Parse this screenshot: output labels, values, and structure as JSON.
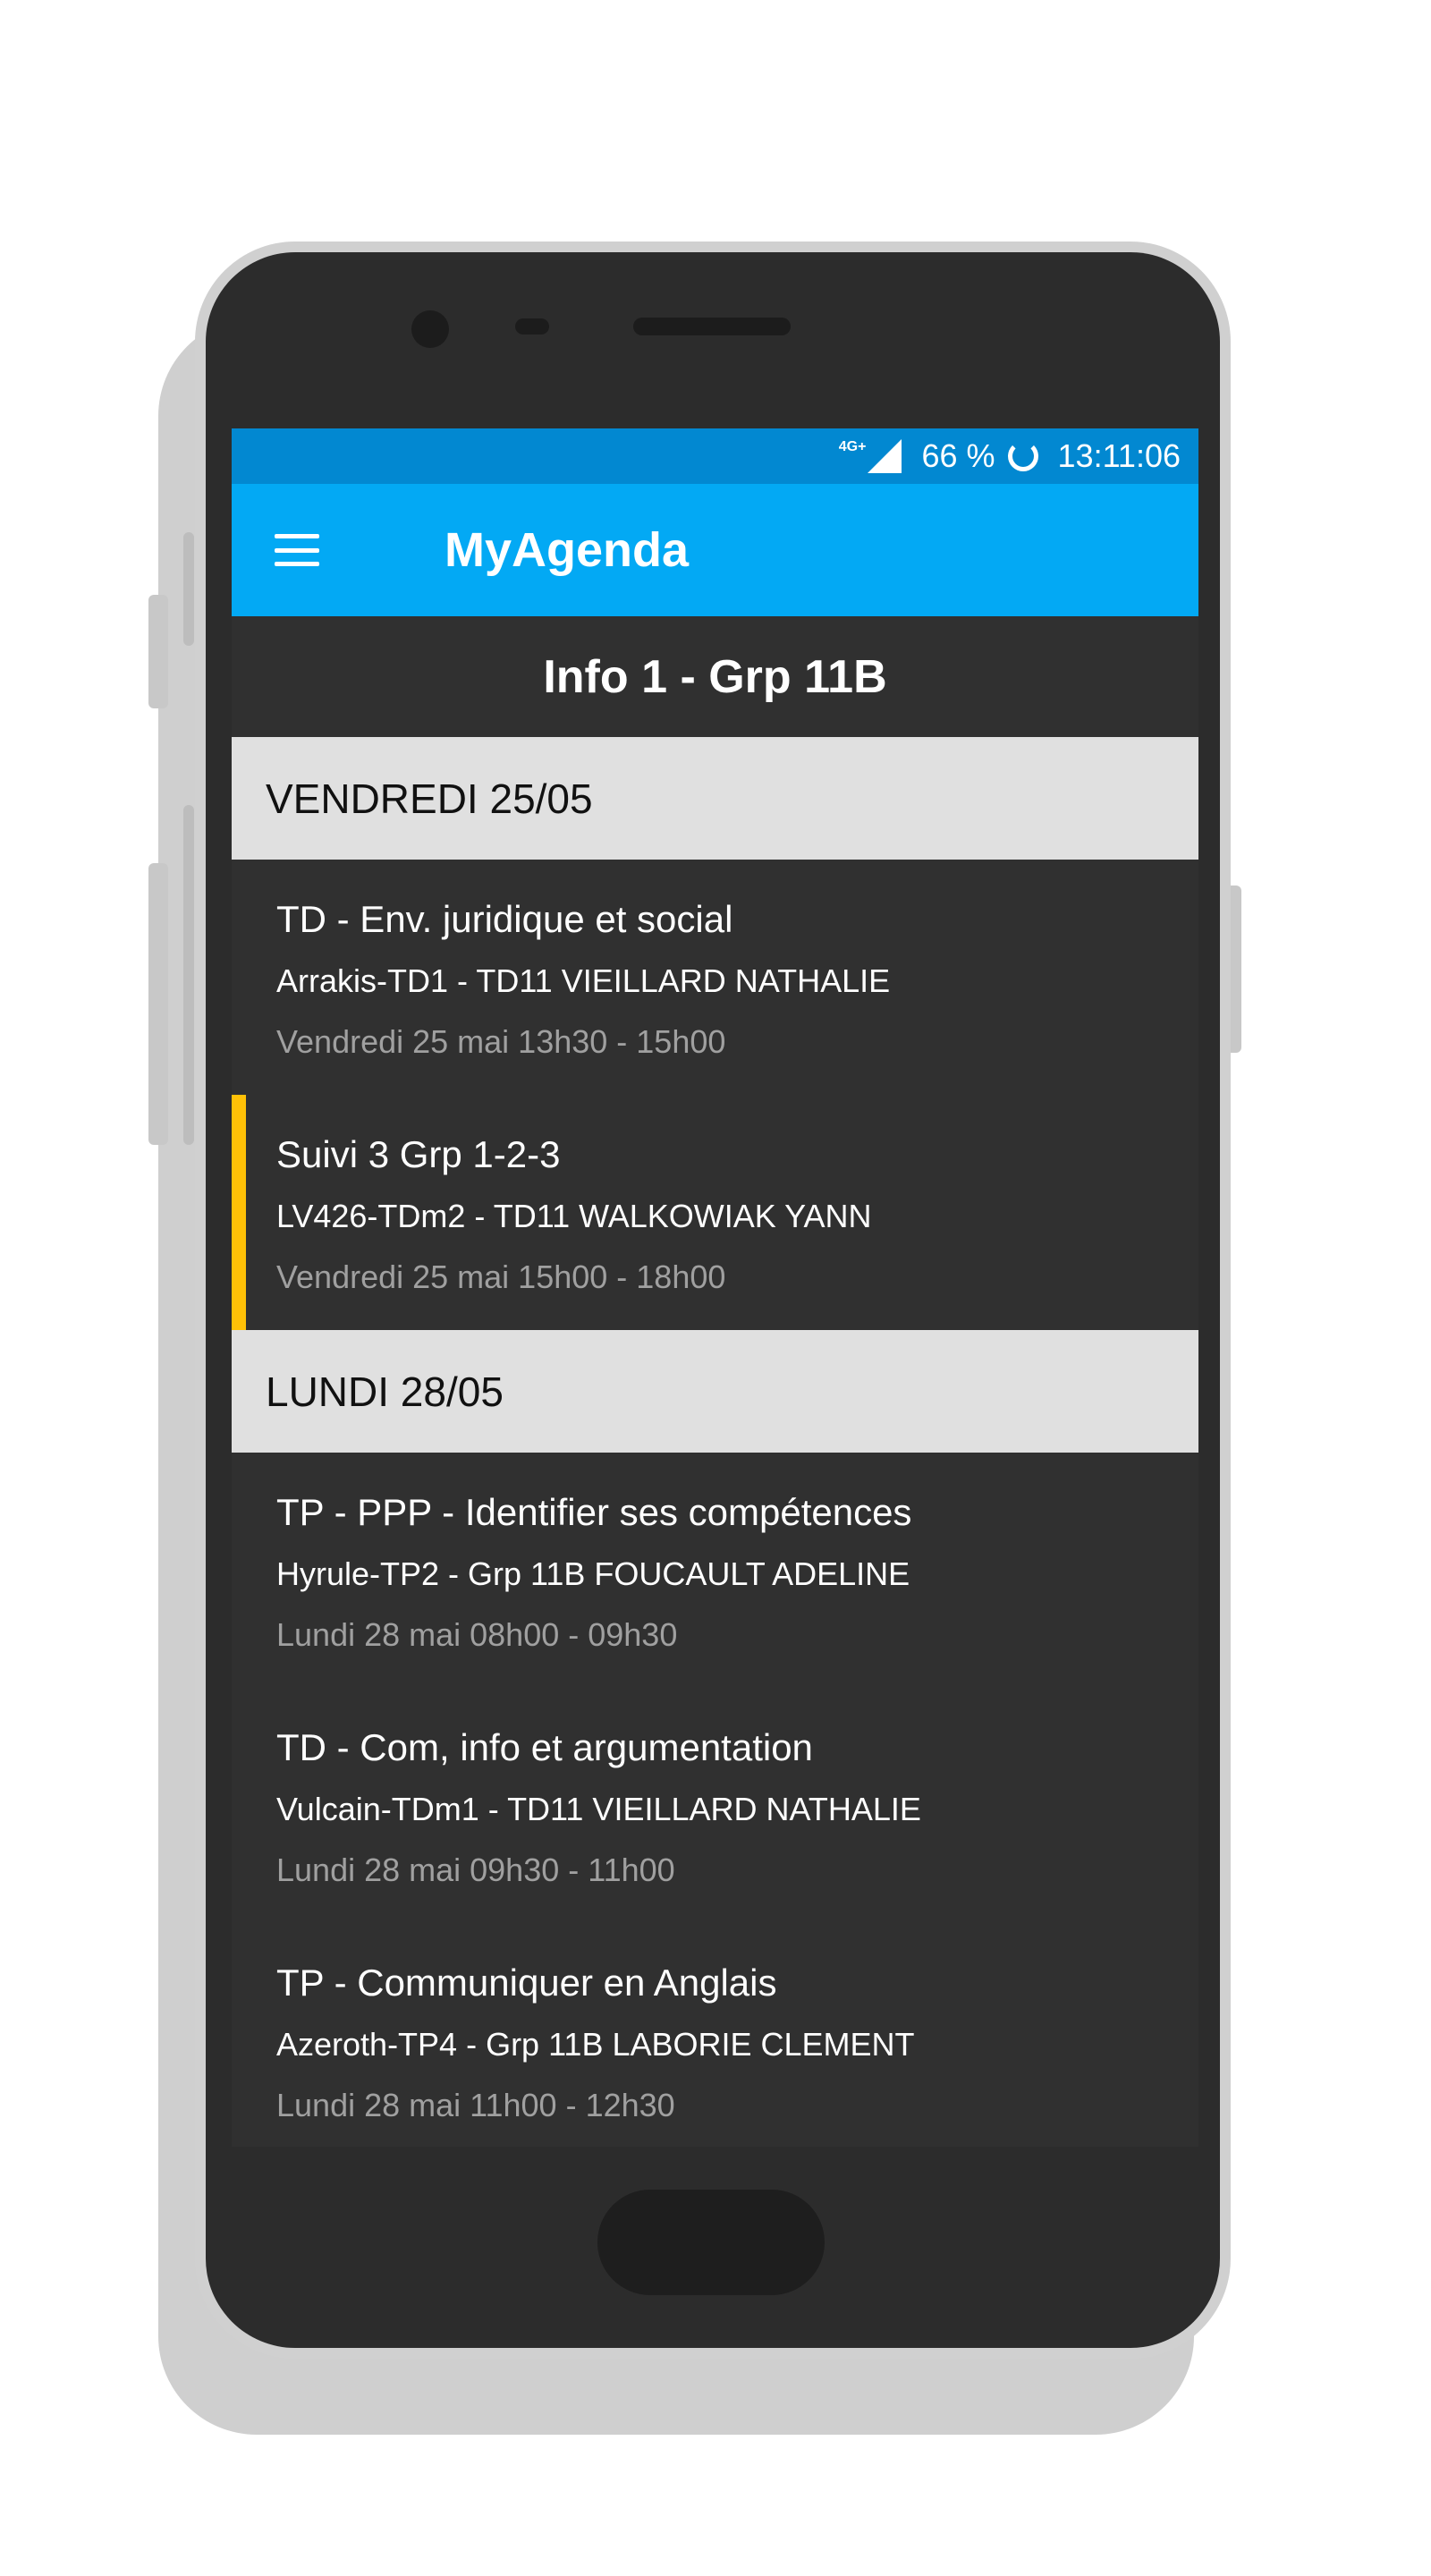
{
  "status_bar": {
    "network": "4G+",
    "battery": "66 %",
    "time": "13:11:06"
  },
  "app_bar": {
    "title": "MyAgenda",
    "menu_icon": "hamburger-menu-icon"
  },
  "group": {
    "name": "Info 1 - Grp 11B"
  },
  "colors": {
    "status_bar": "#0288d1",
    "app_bar": "#03a9f4",
    "background": "#303030",
    "day_header": "#e0e0e0",
    "accent_event": "#ffc107"
  },
  "days": [
    {
      "label": "VENDREDI 25/05",
      "events": [
        {
          "title": "TD - Env. juridique et social",
          "room": "Arrakis-TD1 - TD11 VIEILLARD NATHALIE",
          "time": "Vendredi 25 mai 13h30 - 15h00"
        },
        {
          "title": "Suivi 3 Grp 1-2-3",
          "room": "LV426-TDm2 - TD11 WALKOWIAK YANN",
          "time": "Vendredi 25 mai 15h00 - 18h00",
          "highlighted": true
        }
      ]
    },
    {
      "label": "LUNDI 28/05",
      "events": [
        {
          "title": "TP - PPP - Identifier ses compétences",
          "room": "Hyrule-TP2 - Grp 11B FOUCAULT ADELINE",
          "time": "Lundi 28 mai 08h00 - 09h30"
        },
        {
          "title": "TD - Com, info et argumentation",
          "room": "Vulcain-TDm1 - TD11 VIEILLARD NATHALIE",
          "time": "Lundi 28 mai 09h30 - 11h00"
        },
        {
          "title": "TP - Communiquer en Anglais",
          "room": "Azeroth-TP4 - Grp 11B LABORIE CLEMENT",
          "time": "Lundi 28 mai 11h00 - 12h30"
        }
      ]
    }
  ]
}
